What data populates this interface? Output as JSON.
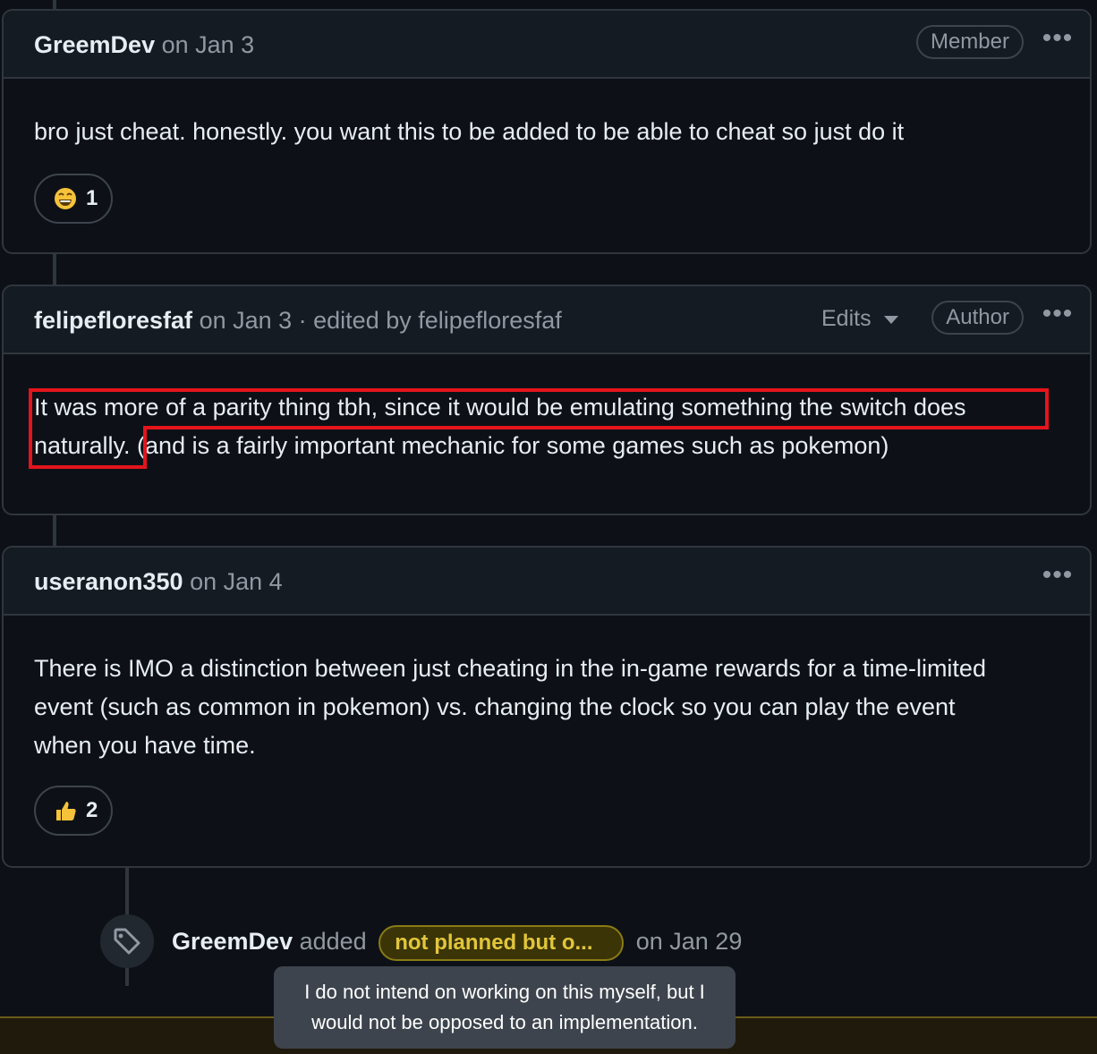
{
  "comments": [
    {
      "author": "GreemDev",
      "meta": "on Jan 3",
      "badge": "Member",
      "body": "bro just cheat. honestly. you want this to be added to be able to cheat so just do it",
      "reaction": {
        "emoji": "grinning-face",
        "count": "1"
      }
    },
    {
      "author": "felipefloresfaf",
      "meta": "on Jan 3 · edited by felipefloresfaf",
      "edits_label": "Edits",
      "badge": "Author",
      "body_line1": "It was more of a parity thing tbh, since it would be emulating something the switch does",
      "body_line2": "naturally. (and is a fairly important mechanic for some games such as pokemon)"
    },
    {
      "author": "useranon350",
      "meta": "on Jan 4",
      "body_line1": "There is IMO a distinction between just cheating in the in-game rewards for a time-limited",
      "body_line2": "event (such as common in pokemon) vs. changing the clock so you can play the event",
      "body_line3": "when you have time.",
      "reaction": {
        "emoji": "thumbs-up",
        "count": "2"
      }
    }
  ],
  "event": {
    "actor": "GreemDev",
    "action": "added",
    "label": "not planned but o...",
    "date": "on Jan 29",
    "tooltip_line1": "I do not intend on working on this myself, but I",
    "tooltip_line2": "would not be opposed to an implementation."
  },
  "colors": {
    "highlight": "#e5141c",
    "label_bg": "#3a3407",
    "label_text": "#e2c63a"
  }
}
